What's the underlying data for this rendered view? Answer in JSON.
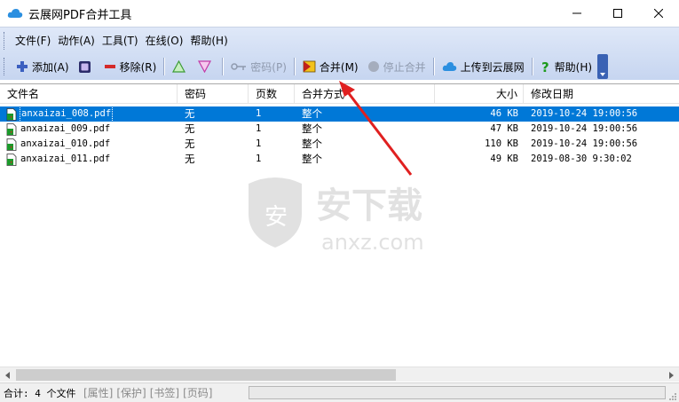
{
  "window": {
    "title": "云展网PDF合并工具",
    "icon": "cloud-icon",
    "controls": [
      "minimize",
      "maximize",
      "close"
    ]
  },
  "menu": {
    "items": [
      {
        "label": "文件(F)"
      },
      {
        "label": "动作(A)"
      },
      {
        "label": "工具(T)"
      },
      {
        "label": "在线(O)"
      },
      {
        "label": "帮助(H)"
      }
    ]
  },
  "toolbar": {
    "add": {
      "label": "添加(A)",
      "icon": "plus-icon"
    },
    "select": {
      "icon": "square-icon"
    },
    "remove": {
      "label": "移除(R)",
      "icon": "minus-icon"
    },
    "move_up": {
      "icon": "triangle-up-icon"
    },
    "move_down": {
      "icon": "triangle-down-icon"
    },
    "password": {
      "label": "密码(P)",
      "icon": "key-icon",
      "enabled": false
    },
    "merge": {
      "label": "合并(M)",
      "icon": "merge-icon"
    },
    "stop": {
      "label": "停止合并",
      "icon": "stop-circle-icon",
      "enabled": false
    },
    "upload": {
      "label": "上传到云展网",
      "icon": "cloud-icon"
    },
    "help": {
      "label": "帮助(H)",
      "icon": "question-icon"
    }
  },
  "table": {
    "columns": [
      "文件名",
      "密码",
      "页数",
      "合并方式",
      "大小",
      "修改日期"
    ],
    "rows": [
      {
        "name": "anxaizai_008.pdf",
        "password": "无",
        "pages": "1",
        "mode": "整个",
        "size": "46 KB",
        "date": "2019-10-24 19:00:56",
        "selected": true
      },
      {
        "name": "anxaizai_009.pdf",
        "password": "无",
        "pages": "1",
        "mode": "整个",
        "size": "47 KB",
        "date": "2019-10-24 19:00:56",
        "selected": false
      },
      {
        "name": "anxaizai_010.pdf",
        "password": "无",
        "pages": "1",
        "mode": "整个",
        "size": "110 KB",
        "date": "2019-10-24 19:00:56",
        "selected": false
      },
      {
        "name": "anxaizai_011.pdf",
        "password": "无",
        "pages": "1",
        "mode": "整个",
        "size": "49 KB",
        "date": "2019-08-30 9:30:02",
        "selected": false
      }
    ]
  },
  "watermark": {
    "brand": "安下载",
    "domain": "anxz.com"
  },
  "statusbar": {
    "count": "合计: 4 个文件",
    "items": [
      "[属性]",
      "[保护]",
      "[书签]",
      "[页码]"
    ]
  },
  "colors": {
    "selection": "#0078d7",
    "toolbar_bg": "#c6d5f0",
    "arrow": "#e02020"
  }
}
